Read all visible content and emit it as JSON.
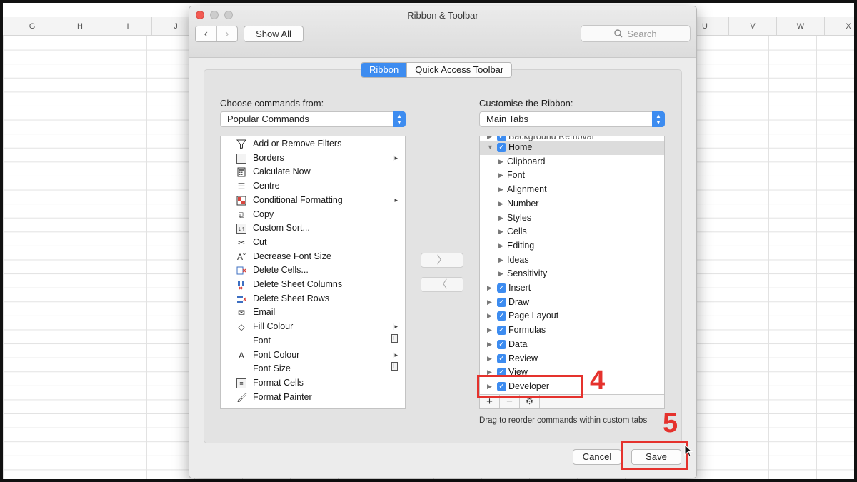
{
  "spreadsheet": {
    "columns_left": [
      "G",
      "H",
      "I",
      "J"
    ],
    "columns_right": [
      "U",
      "V",
      "W",
      "X"
    ]
  },
  "dialog": {
    "title": "Ribbon & Toolbar",
    "show_all_label": "Show All",
    "search_placeholder": "Search",
    "tabs": [
      {
        "label": "Ribbon",
        "active": true
      },
      {
        "label": "Quick Access Toolbar",
        "active": false
      }
    ],
    "left": {
      "label": "Choose commands from:",
      "selected": "Popular Commands",
      "commands": [
        {
          "label": "Add or Remove Filters",
          "icon": "filter-icon",
          "submenu": ""
        },
        {
          "label": "Borders",
          "icon": "borders-icon",
          "submenu": "|▸"
        },
        {
          "label": "Calculate Now",
          "icon": "calculator-icon",
          "submenu": ""
        },
        {
          "label": "Centre",
          "icon": "align-center-icon",
          "submenu": ""
        },
        {
          "label": "Conditional Formatting",
          "icon": "conditional-formatting-icon",
          "submenu": "▸"
        },
        {
          "label": "Copy",
          "icon": "copy-icon",
          "submenu": ""
        },
        {
          "label": "Custom Sort...",
          "icon": "custom-sort-icon",
          "submenu": ""
        },
        {
          "label": "Cut",
          "icon": "scissors-icon",
          "submenu": ""
        },
        {
          "label": "Decrease Font Size",
          "icon": "decrease-font-icon",
          "submenu": ""
        },
        {
          "label": "Delete Cells...",
          "icon": "delete-cells-icon",
          "submenu": ""
        },
        {
          "label": "Delete Sheet Columns",
          "icon": "delete-columns-icon",
          "submenu": ""
        },
        {
          "label": "Delete Sheet Rows",
          "icon": "delete-rows-icon",
          "submenu": ""
        },
        {
          "label": "Email",
          "icon": "email-icon",
          "submenu": ""
        },
        {
          "label": "Fill Colour",
          "icon": "fill-colour-icon",
          "submenu": "|▸"
        },
        {
          "label": "Font",
          "icon": "",
          "submenu": "I·"
        },
        {
          "label": "Font Colour",
          "icon": "font-colour-icon",
          "submenu": "|▸"
        },
        {
          "label": "Font Size",
          "icon": "",
          "submenu": "I·"
        },
        {
          "label": "Format Cells",
          "icon": "format-cells-icon",
          "submenu": ""
        },
        {
          "label": "Format Painter",
          "icon": "format-painter-icon",
          "submenu": ""
        }
      ]
    },
    "right": {
      "label": "Customise the Ribbon:",
      "selected": "Main Tabs",
      "tree": [
        {
          "label": "Background Removal",
          "level": 0,
          "checked": true,
          "expanded": false,
          "partial": true
        },
        {
          "label": "Home",
          "level": 0,
          "checked": true,
          "expanded": true,
          "selected": true
        },
        {
          "label": "Clipboard",
          "level": 1
        },
        {
          "label": "Font",
          "level": 1
        },
        {
          "label": "Alignment",
          "level": 1
        },
        {
          "label": "Number",
          "level": 1
        },
        {
          "label": "Styles",
          "level": 1
        },
        {
          "label": "Cells",
          "level": 1
        },
        {
          "label": "Editing",
          "level": 1
        },
        {
          "label": "Ideas",
          "level": 1
        },
        {
          "label": "Sensitivity",
          "level": 1
        },
        {
          "label": "Insert",
          "level": 0,
          "checked": true
        },
        {
          "label": "Draw",
          "level": 0,
          "checked": true
        },
        {
          "label": "Page Layout",
          "level": 0,
          "checked": true
        },
        {
          "label": "Formulas",
          "level": 0,
          "checked": true
        },
        {
          "label": "Data",
          "level": 0,
          "checked": true
        },
        {
          "label": "Review",
          "level": 0,
          "checked": true
        },
        {
          "label": "View",
          "level": 0,
          "checked": true
        },
        {
          "label": "Developer",
          "level": 0,
          "checked": true
        }
      ],
      "toolbar": {
        "add": "+",
        "remove": "−",
        "settings": "⚙"
      },
      "hint": "Drag to reorder commands within custom tabs"
    },
    "move_right": "〉",
    "move_left": "〈",
    "cancel_label": "Cancel",
    "save_label": "Save"
  },
  "annotations": {
    "step4": "4",
    "step5": "5",
    "color": "#e5322d"
  },
  "accent_color": "#3d8cf0"
}
